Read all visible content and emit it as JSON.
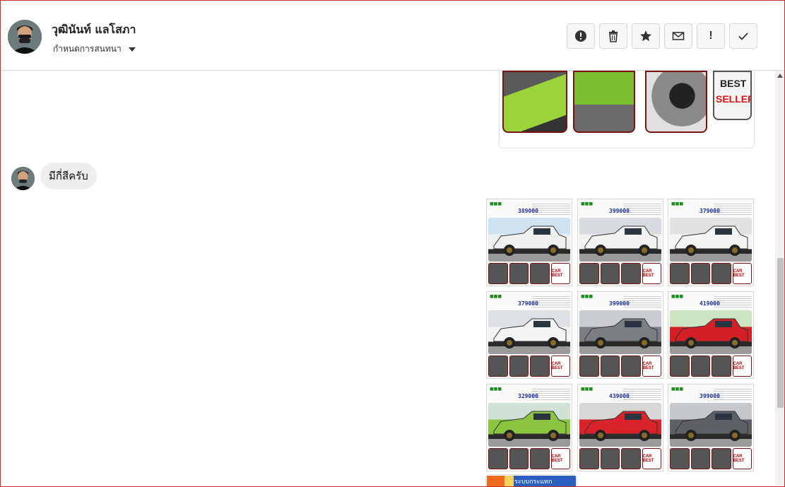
{
  "header": {
    "contact_name": "วุฒินันท์ แลโสภา",
    "assign_label": "กำหนดการสนทนา",
    "toolbar": [
      {
        "name": "alert-circle-icon"
      },
      {
        "name": "trash-icon"
      },
      {
        "name": "star-icon"
      },
      {
        "name": "envelope-icon"
      },
      {
        "name": "exclamation-icon",
        "glyph": "!"
      },
      {
        "name": "check-icon"
      }
    ]
  },
  "messages": {
    "incoming_text": "มีกี่สีครับ",
    "top_image_best": "BEST",
    "top_image_seller": "SELLER"
  },
  "posters": [
    {
      "price": "389000",
      "color": "#f0f0f0",
      "bg": "#cfe3f2"
    },
    {
      "price": "399000",
      "color": "#f2f2f2",
      "bg": "#d8dbe0"
    },
    {
      "price": "379000",
      "color": "#f4f4f4",
      "bg": "#e2e2e2"
    },
    {
      "price": "379000",
      "color": "#f3f3f3",
      "bg": "#dde0e4"
    },
    {
      "price": "399000",
      "color": "#7b7f84",
      "bg": "#c9ccd0"
    },
    {
      "price": "419000",
      "color": "#d41f26",
      "bg": "#cde4c2"
    },
    {
      "price": "329000",
      "color": "#8bc53f",
      "bg": "#d0e1d6"
    },
    {
      "price": "439000",
      "color": "#d8232a",
      "bg": "#d7d7d7"
    },
    {
      "price": "399000",
      "color": "#5d6166",
      "bg": "#c5c9cc"
    }
  ],
  "poster_badge": "CAR BEST",
  "peek_text": "ระบบกระแทก"
}
